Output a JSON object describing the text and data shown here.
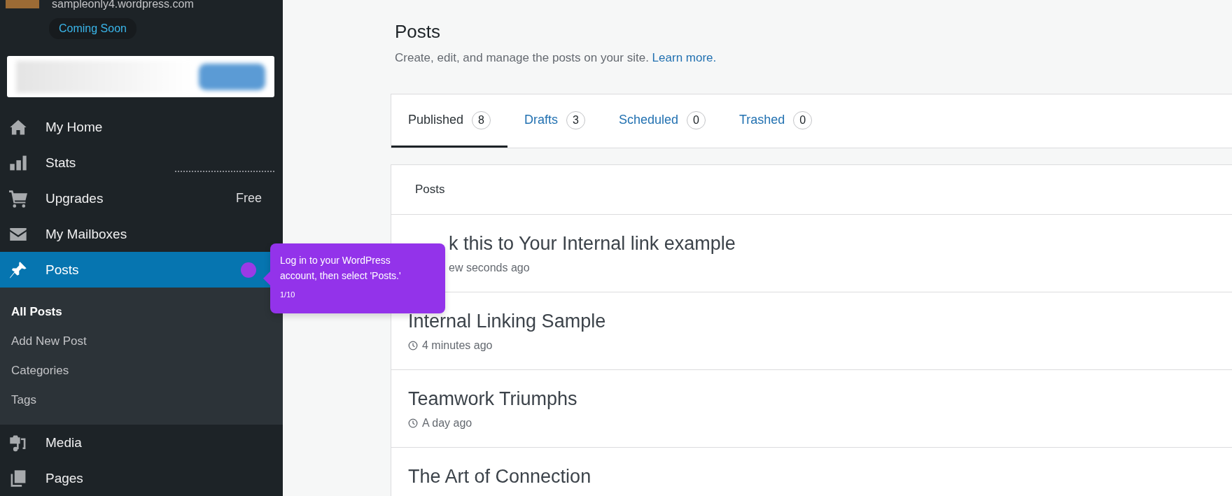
{
  "site": {
    "address": "sampleonly4.wordpress.com",
    "status_badge": "Coming Soon"
  },
  "sidebar": {
    "items": [
      {
        "kind": "home",
        "label": "My Home",
        "selected": false
      },
      {
        "kind": "stats",
        "label": "Stats",
        "selected": false
      },
      {
        "kind": "cart",
        "label": "Upgrades",
        "badge": "Free",
        "selected": false
      },
      {
        "kind": "mail",
        "label": "My Mailboxes",
        "selected": false
      },
      {
        "kind": "pin",
        "label": "Posts",
        "selected": true,
        "children": [
          {
            "label": "All Posts",
            "selected": true
          },
          {
            "label": "Add New Post",
            "selected": false
          },
          {
            "label": "Categories",
            "selected": false
          },
          {
            "label": "Tags",
            "selected": false
          }
        ]
      },
      {
        "kind": "media",
        "label": "Media",
        "selected": false
      },
      {
        "kind": "pages",
        "label": "Pages",
        "selected": false
      }
    ]
  },
  "page": {
    "title": "Posts",
    "description": "Create, edit, and manage the posts on your site.",
    "link": "Learn more."
  },
  "tabs": [
    {
      "label": "Published",
      "count": "8",
      "selected": true
    },
    {
      "label": "Drafts",
      "count": "3",
      "selected": false
    },
    {
      "label": "Scheduled",
      "count": "0",
      "selected": false
    },
    {
      "label": "Trashed",
      "count": "0",
      "selected": false
    }
  ],
  "posts": {
    "heading": "Posts",
    "rows": [
      {
        "title": "k this to Your Internal link example",
        "meta": "ew seconds ago"
      },
      {
        "title": "Internal Linking Sample",
        "meta": "4 minutes ago"
      },
      {
        "title": "Teamwork Triumphs",
        "meta": "A day ago"
      },
      {
        "title": "The Art of Connection"
      }
    ]
  },
  "tooltip": {
    "text": "Log in to your WordPress account, then select 'Posts.'",
    "step": "1/10"
  }
}
